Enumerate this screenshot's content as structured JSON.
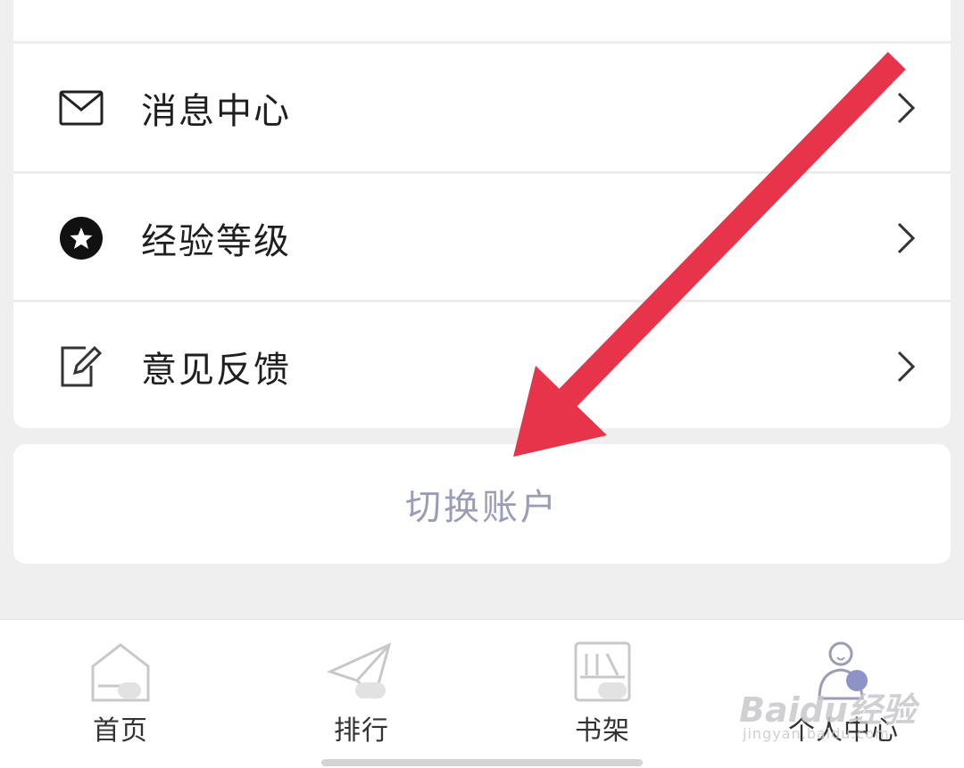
{
  "menu": {
    "items": [
      {
        "label": "消息中心",
        "icon": "mail-icon"
      },
      {
        "label": "经验等级",
        "icon": "star-badge-icon"
      },
      {
        "label": "意见反馈",
        "icon": "edit-icon"
      }
    ]
  },
  "switch_account": {
    "label": "切换账户"
  },
  "tabbar": {
    "tabs": [
      {
        "label": "首页",
        "icon": "home-icon"
      },
      {
        "label": "排行",
        "icon": "paper-plane-icon"
      },
      {
        "label": "书架",
        "icon": "bookshelf-icon"
      },
      {
        "label": "个人中心",
        "icon": "user-icon",
        "active": true
      }
    ]
  },
  "watermark": {
    "brand": "Baidu经验",
    "url": "jingyan.baidu.com"
  },
  "colors": {
    "background": "#efefef",
    "card": "#ffffff",
    "switch_text": "#9a9cb8",
    "active_tab": "#8f92c7",
    "arrow": "#e8344a"
  }
}
